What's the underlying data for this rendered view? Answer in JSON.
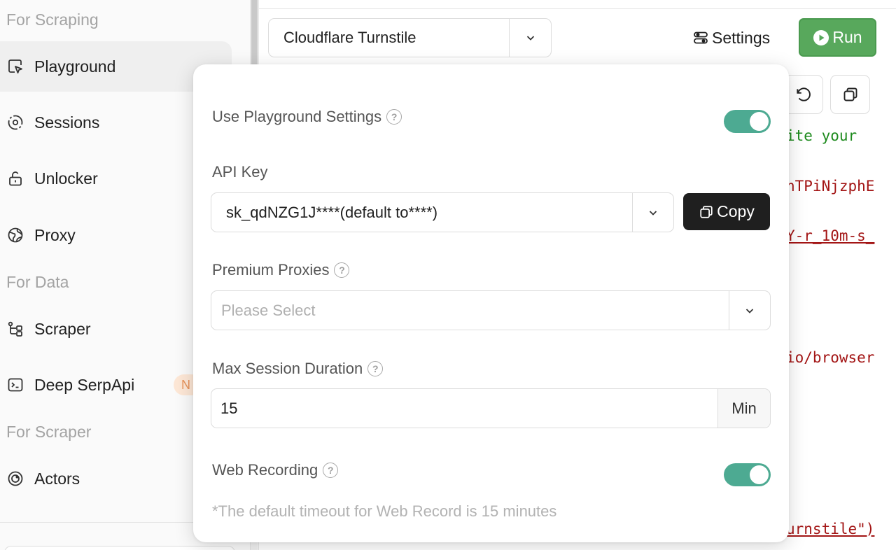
{
  "sidebar": {
    "sections": {
      "scraping": "For Scraping",
      "data": "For Data",
      "scraper": "For Scraper"
    },
    "items": [
      {
        "label": "Playground",
        "icon": "cursor-box-icon",
        "active": true
      },
      {
        "label": "Sessions",
        "icon": "sessions-icon"
      },
      {
        "label": "Unlocker",
        "icon": "unlock-icon"
      },
      {
        "label": "Proxy",
        "icon": "globe-icon"
      },
      {
        "label": "Scraper",
        "icon": "scraper-icon"
      },
      {
        "label": "Deep SerpApi",
        "icon": "terminal-icon"
      },
      {
        "label": "Actors",
        "icon": "actors-icon"
      }
    ],
    "badge": "N"
  },
  "toolbar": {
    "template_select": "Cloudflare Turnstile",
    "settings_label": "Settings",
    "run_label": "Run"
  },
  "code_fragments": {
    "line1": "ite your",
    "line2": "nTPiNjzphE",
    "line3": "Y-r_10m-s_",
    "line4": "io/browser",
    "line5": "urnstile\")"
  },
  "settings": {
    "use_playground": {
      "label": "Use Playground Settings",
      "enabled": true
    },
    "api_key": {
      "label": "API Key",
      "value": "sk_qdNZG1J****(default to****)",
      "copy_label": "Copy"
    },
    "premium_proxies": {
      "label": "Premium Proxies",
      "placeholder": "Please Select"
    },
    "max_session": {
      "label": "Max Session Duration",
      "value": "15",
      "unit": "Min"
    },
    "web_recording": {
      "label": "Web Recording",
      "enabled": true
    },
    "note": "*The default timeout for Web Record is 15 minutes"
  },
  "colors": {
    "run_green": "#58a85c",
    "toggle_teal": "#4daa92",
    "copy_black": "#1f1f1f"
  }
}
